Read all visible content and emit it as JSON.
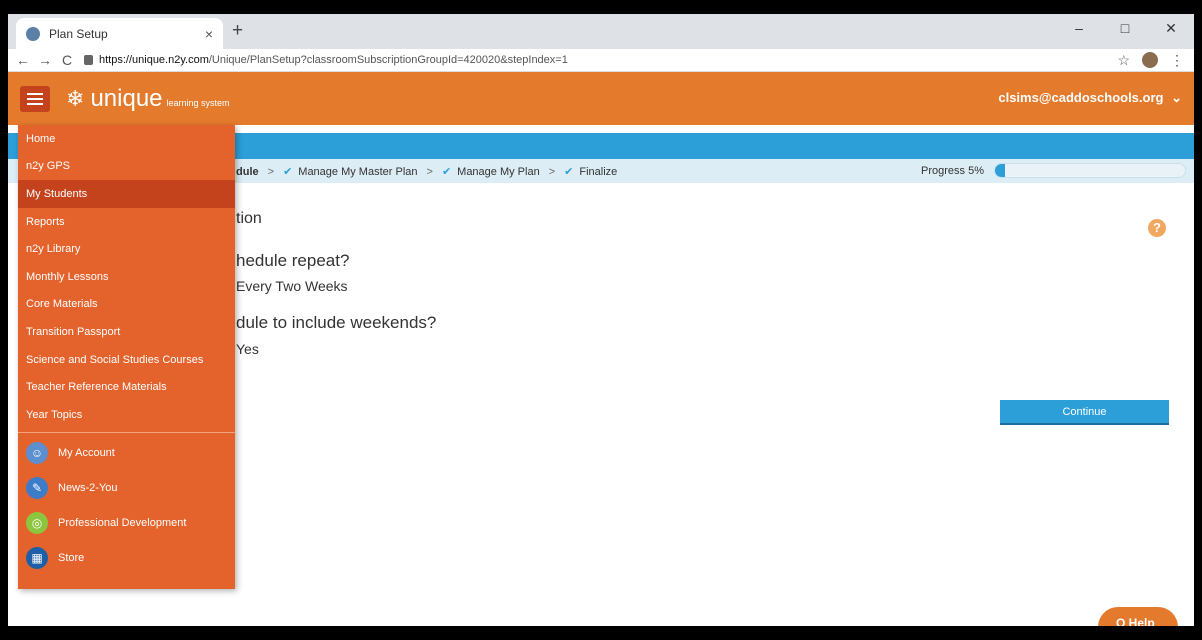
{
  "browser": {
    "tab_title": "Plan Setup",
    "tab_close": "×",
    "new_tab": "+",
    "window_controls": [
      "–",
      "□",
      "✕"
    ],
    "nav": {
      "back": "←",
      "forward": "→",
      "reload": "C"
    },
    "url_host": "https://unique.n2y.com",
    "url_path": "/Unique/PlanSetup?classroomSubscriptionGroupId=420020&stepIndex=1",
    "star": "☆",
    "menu": "⋮"
  },
  "header": {
    "logo_mark": "❄",
    "logo_word": "unique",
    "logo_tagline": "learning system",
    "user_email": "clsims@caddoschools.org",
    "user_caret": "⌄",
    "accent": "#e47a2c"
  },
  "steps": {
    "items": [
      {
        "label": "dule",
        "bold": true,
        "check": false
      },
      {
        "label": "Manage My Master Plan",
        "check": true
      },
      {
        "label": "Manage My Plan",
        "check": true
      },
      {
        "label": "Finalize",
        "check": true
      }
    ],
    "separator": ">",
    "check_glyph": "✔",
    "progress_label": "Progress 5%",
    "progress_value": 0.05
  },
  "content": {
    "section_title": "tion",
    "q1": "hedule repeat?",
    "a1": "Every Two Weeks",
    "q2": "dule to include weekends?",
    "a2": "Yes",
    "help_icon": "?",
    "continue_label": "Continue",
    "help_pill": "Q Help"
  },
  "drawer": {
    "items": [
      {
        "label": "Home",
        "active": false
      },
      {
        "label": "n2y GPS",
        "active": false
      },
      {
        "label": "My Students",
        "active": true
      },
      {
        "label": "Reports",
        "active": false
      },
      {
        "label": "n2y Library",
        "active": false
      },
      {
        "label": "Monthly Lessons",
        "active": false
      },
      {
        "label": "Core Materials",
        "active": false
      },
      {
        "label": "Transition Passport",
        "active": false
      },
      {
        "label": "Science and Social Studies Courses",
        "active": false
      },
      {
        "label": "Teacher Reference Materials",
        "active": false
      },
      {
        "label": "Year Topics",
        "active": false
      }
    ],
    "account_items": [
      {
        "label": "My Account",
        "icon": "account-icon",
        "color": "#5b8fd0"
      },
      {
        "label": "News-2-You",
        "icon": "news-icon",
        "color": "#3d7cc9"
      },
      {
        "label": "Professional Development",
        "icon": "compass-icon",
        "color": "#8cc63f"
      },
      {
        "label": "Store",
        "icon": "store-icon",
        "color": "#1f5fa8"
      }
    ]
  }
}
